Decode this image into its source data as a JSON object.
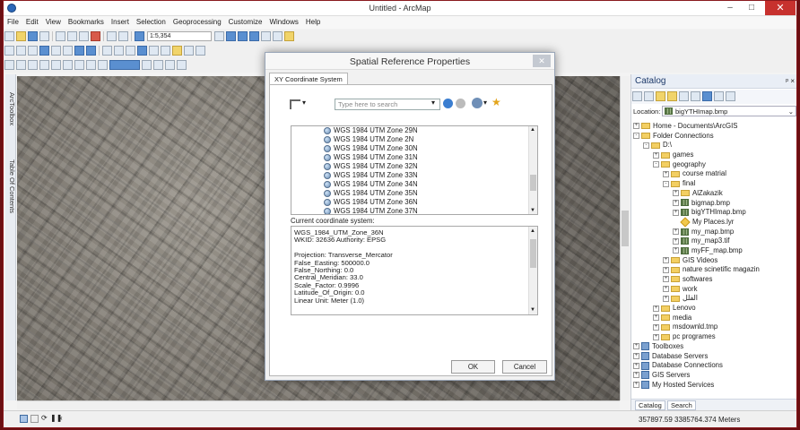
{
  "window": {
    "title": "Untitled - ArcMap",
    "minimize": "–",
    "maximize": "□",
    "close": "✕"
  },
  "menu": [
    "File",
    "Edit",
    "View",
    "Bookmarks",
    "Insert",
    "Selection",
    "Geoprocessing",
    "Customize",
    "Windows",
    "Help"
  ],
  "toolbar": {
    "scale": "1:5,354"
  },
  "left_tabs": {
    "toolbox": "ArcToolbox",
    "toc": "Table Of Contents"
  },
  "status": {
    "coordinates": "357897.59  3385764.374 Meters"
  },
  "catalog": {
    "title": "Catalog",
    "pin": "ᵖ ×",
    "location_label": "Location:",
    "location_value": "bigYTHImap.bmp",
    "tree": [
      {
        "text": "Home - Documents\\ArcGIS",
        "level": 0,
        "icon": "folder-icon",
        "exp": "+"
      },
      {
        "text": "Folder Connections",
        "level": 0,
        "icon": "folder-icon",
        "exp": "-"
      },
      {
        "text": "D:\\",
        "level": 1,
        "icon": "folder-icon",
        "exp": "-"
      },
      {
        "text": "games",
        "level": 2,
        "icon": "folder-icon",
        "exp": "+"
      },
      {
        "text": "geography",
        "level": 2,
        "icon": "folder-icon",
        "exp": "-"
      },
      {
        "text": "course matrial",
        "level": 3,
        "icon": "folder-icon",
        "exp": "+"
      },
      {
        "text": "final",
        "level": 3,
        "icon": "folder-icon",
        "exp": "-"
      },
      {
        "text": "AlZakazik",
        "level": 4,
        "icon": "folder-icon",
        "exp": "+"
      },
      {
        "text": "bigmap.bmp",
        "level": 4,
        "icon": "raster-icon",
        "exp": "+"
      },
      {
        "text": "bigYTHImap.bmp",
        "level": 4,
        "icon": "raster-icon",
        "exp": "+"
      },
      {
        "text": "My Places.lyr",
        "level": 4,
        "icon": "layer-icon",
        "exp": ""
      },
      {
        "text": "my_map.bmp",
        "level": 4,
        "icon": "raster-icon",
        "exp": "+"
      },
      {
        "text": "my_map3.tif",
        "level": 4,
        "icon": "raster-icon",
        "exp": "+"
      },
      {
        "text": "myFF_map.bmp",
        "level": 4,
        "icon": "raster-icon",
        "exp": "+"
      },
      {
        "text": "GIS Videos",
        "level": 3,
        "icon": "folder-icon",
        "exp": "+"
      },
      {
        "text": "nature scinetific magazin",
        "level": 3,
        "icon": "folder-icon",
        "exp": "+"
      },
      {
        "text": "softwares",
        "level": 3,
        "icon": "folder-icon",
        "exp": "+"
      },
      {
        "text": "work",
        "level": 3,
        "icon": "folder-icon",
        "exp": "+"
      },
      {
        "text": "الفلل",
        "level": 3,
        "icon": "folder-icon",
        "exp": "+"
      },
      {
        "text": "Lenovo",
        "level": 2,
        "icon": "folder-icon",
        "exp": "+"
      },
      {
        "text": "media",
        "level": 2,
        "icon": "folder-icon",
        "exp": "+"
      },
      {
        "text": "msdownld.tmp",
        "level": 2,
        "icon": "folder-icon",
        "exp": "+"
      },
      {
        "text": "pc programes",
        "level": 2,
        "icon": "folder-icon",
        "exp": "+"
      },
      {
        "text": "Toolboxes",
        "level": 0,
        "icon": "toolbox-icon",
        "exp": "+"
      },
      {
        "text": "Database Servers",
        "level": 0,
        "icon": "database-icon",
        "exp": "+"
      },
      {
        "text": "Database Connections",
        "level": 0,
        "icon": "database-icon",
        "exp": "+"
      },
      {
        "text": "GIS Servers",
        "level": 0,
        "icon": "database-icon",
        "exp": "+"
      },
      {
        "text": "My Hosted Services",
        "level": 0,
        "icon": "database-icon",
        "exp": "+"
      }
    ],
    "tabs": {
      "catalog": "Catalog",
      "search": "Search"
    }
  },
  "dialog": {
    "title": "Spatial Reference Properties",
    "close": "✕",
    "tab": "XY Coordinate System",
    "search_placeholder": "Type here to search",
    "list": [
      "WGS 1984 UTM Zone 29N",
      "WGS 1984 UTM Zone 2N",
      "WGS 1984 UTM Zone 30N",
      "WGS 1984 UTM Zone 31N",
      "WGS 1984 UTM Zone 32N",
      "WGS 1984 UTM Zone 33N",
      "WGS 1984 UTM Zone 34N",
      "WGS 1984 UTM Zone 35N",
      "WGS 1984 UTM Zone 36N",
      "WGS 1984 UTM Zone 37N"
    ],
    "current_label": "Current coordinate system:",
    "current": [
      "WGS_1984_UTM_Zone_36N",
      "WKID: 32636 Authority: EPSG",
      "",
      "Projection: Transverse_Mercator",
      "False_Easting: 500000.0",
      "False_Northing: 0.0",
      "Central_Meridian: 33.0",
      "Scale_Factor: 0.9996",
      "Latitude_Of_Origin: 0.0",
      "Linear Unit: Meter (1.0)"
    ],
    "ok": "OK",
    "cancel": "Cancel"
  }
}
